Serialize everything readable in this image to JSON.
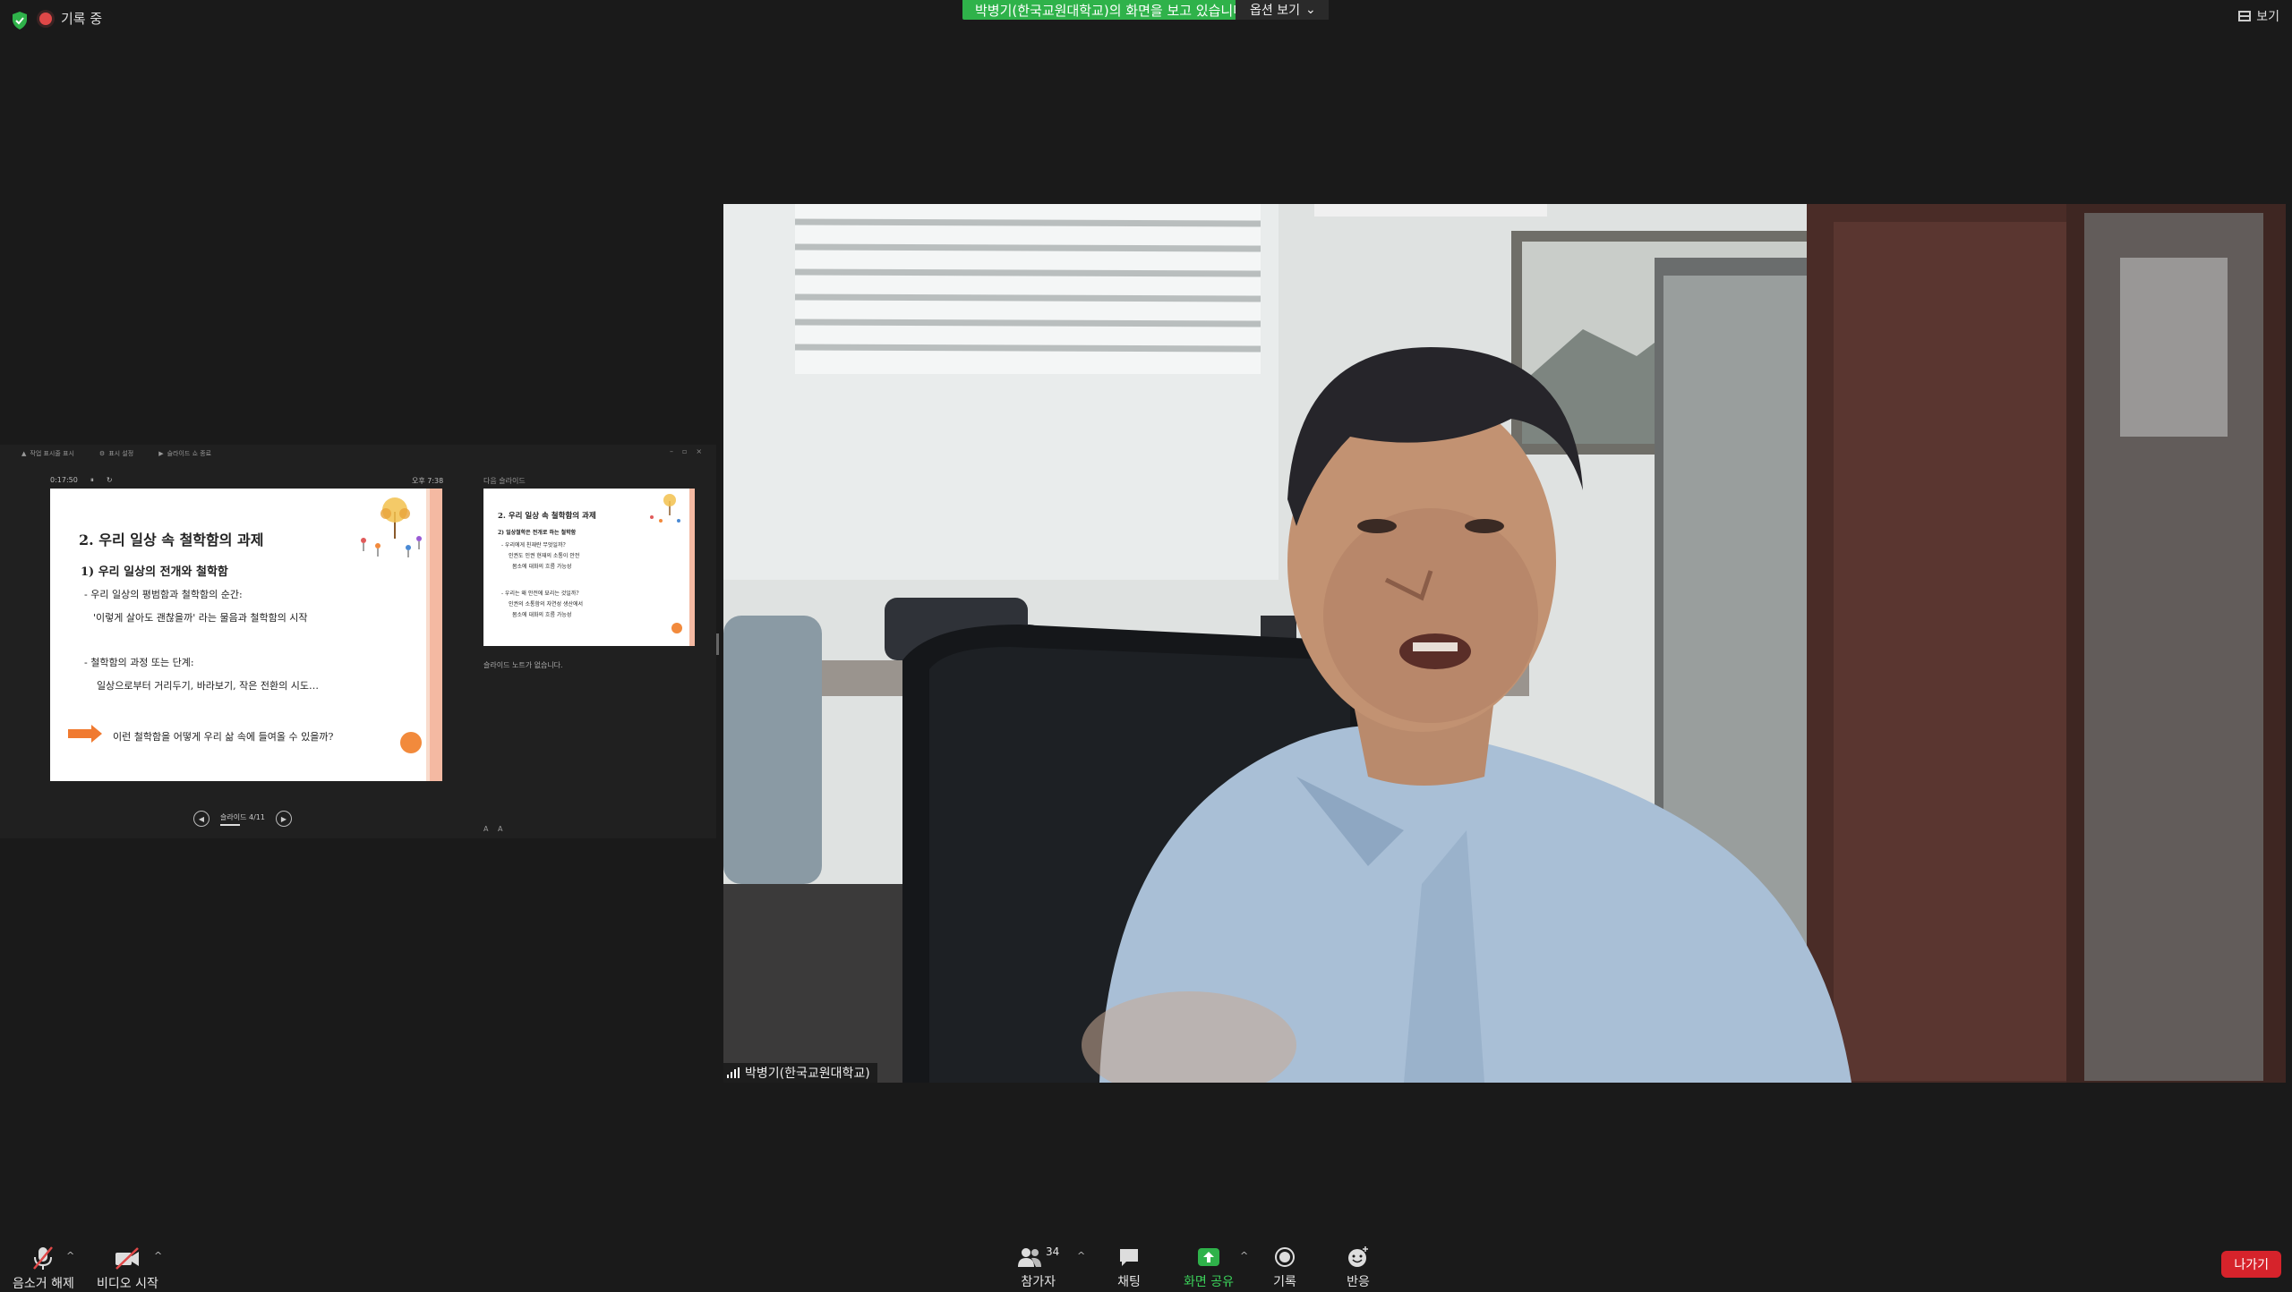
{
  "topbar": {
    "recording_label": "기록 중",
    "share_banner": "박병기(한국교원대학교)의 화면을 보고 있습니다.",
    "view_options": "옵션 보기",
    "view_button": "보기"
  },
  "presenter": {
    "toolbar": [
      "작업 표시줄 표시",
      "표시 설정",
      "슬라이드 쇼 종료"
    ],
    "timer": "0:17:50",
    "clock": "오후 7:38",
    "next_label": "다음 슬라이드",
    "notes": "슬라이드 노트가 없습니다.",
    "slide_counter": "슬라이드 4/11",
    "current_slide": {
      "title": "2. 우리 일상 속 철학함의 과제",
      "subtitle": "1) 우리 일상의 전개와 철학함",
      "line1": "- 우리 일상의 평범함과 철학함의 순간:",
      "line2": "'이렇게 살아도 괜찮을까' 라는 물음과 철학함의 시작",
      "line3": "- 철학함의 과정 또는 단계:",
      "line4": "일상으로부터 거리두기, 바라보기, 작은 전환의 시도…",
      "question": "이런 철학함을 어떻게 우리 삶 속에 들여올 수 있을까?"
    },
    "next_slide": {
      "title": "2. 우리 일상 속 철학함의 과제",
      "line1": "2) 일상철학은 전개로 하는 철학함",
      "line2": "- 우리에게 친재란 무엇일까?",
      "line3": "인권도 인권 현재의 소통이 안전",
      "line4": "몸소에 대화의 흐름 가능성",
      "line5": "- 우리는 왜 안전에 묘리는 것일까?",
      "line6": "인권의 소통함의 자연성 생산에서",
      "line7": "몸소에 대화의 흐름 가능성"
    }
  },
  "video": {
    "participant_name": "박병기(한국교원대학교)"
  },
  "bottombar": {
    "unmute": "음소거 해제",
    "start_video": "비디오 시작",
    "participants": "참가자",
    "participant_count": "34",
    "chat": "채팅",
    "share_screen": "화면 공유",
    "record": "기록",
    "reactions": "반응",
    "leave": "나가기"
  },
  "colors": {
    "share_green": "#2fb24a",
    "leave_red": "#d6232b",
    "slide_accent": "#f28a3c"
  }
}
